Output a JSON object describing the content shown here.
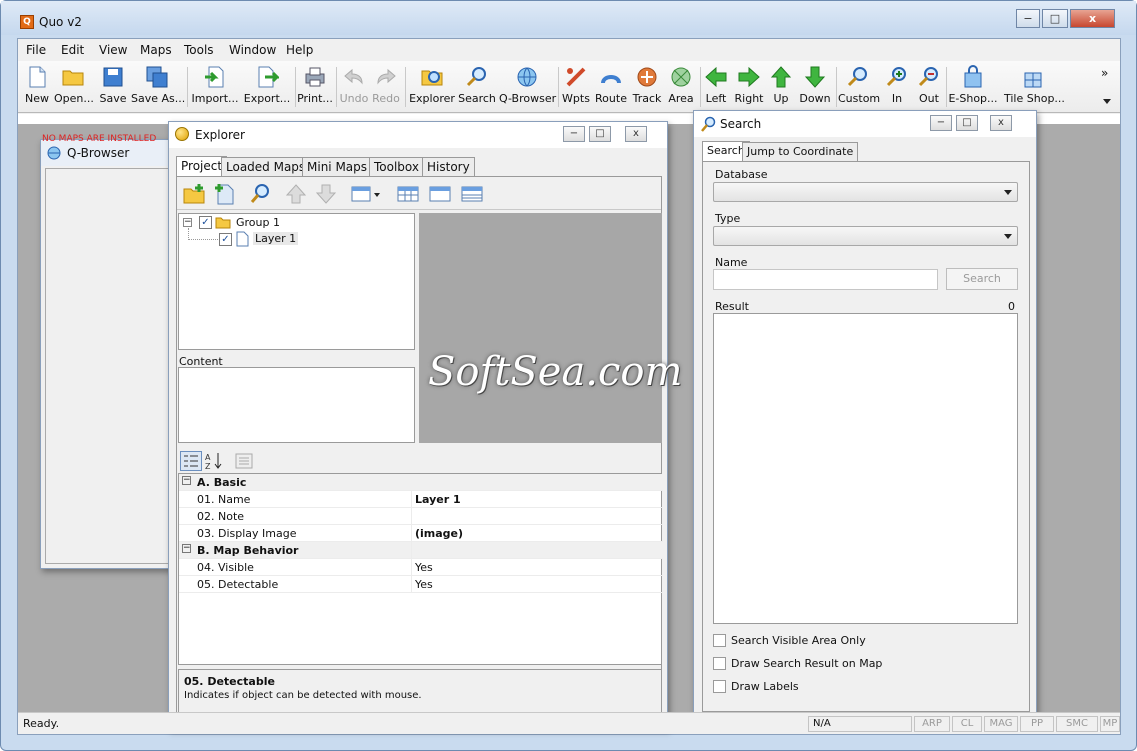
{
  "window": {
    "title": "Quo v2",
    "app_icon": "Q",
    "min": "−",
    "max": "□",
    "close": "x"
  },
  "menu": [
    "File",
    "Edit",
    "View",
    "Maps",
    "Tools",
    "Window",
    "Help"
  ],
  "toolbar": {
    "items": [
      "New",
      "Open...",
      "Save",
      "Save As...",
      "Import...",
      "Export...",
      "Print...",
      "Undo",
      "Redo",
      "Explorer",
      "Search",
      "Q-Browser",
      "Wpts",
      "Route",
      "Track",
      "Area",
      "Left",
      "Right",
      "Up",
      "Down",
      "Custom",
      "In",
      "Out",
      "E-Shop...",
      "Tile Shop..."
    ],
    "overflow": "»"
  },
  "status": {
    "ready": "Ready.",
    "coord": "N/A",
    "cells": [
      "ARP",
      "CL",
      "MAG",
      "PP",
      "SMC",
      "MP"
    ]
  },
  "qbrowser": {
    "title": "Q-Browser",
    "banner": "NO MAPS ARE INSTALLED"
  },
  "explorer": {
    "title": "Explorer",
    "tabs": [
      "Project",
      "Loaded Maps",
      "Mini Maps",
      "Toolbox",
      "History"
    ],
    "tree": {
      "group": "Group 1",
      "layer": "Layer 1",
      "expand": "−",
      "check": "✓"
    },
    "content_label": "Content",
    "props": [
      {
        "kind": "cat",
        "key": "A. Basic",
        "val": ""
      },
      {
        "kind": "row",
        "key": "01. Name",
        "val": "Layer 1"
      },
      {
        "kind": "row",
        "key": "02. Note",
        "val": ""
      },
      {
        "kind": "row",
        "key": "03. Display Image",
        "val": "(image)"
      },
      {
        "kind": "cat",
        "key": "B. Map Behavior",
        "val": ""
      },
      {
        "kind": "row",
        "key": "04. Visible",
        "val": "Yes"
      },
      {
        "kind": "row",
        "key": "05. Detectable",
        "val": "Yes"
      }
    ],
    "help_title": "05. Detectable",
    "help_text": "Indicates if object can be detected with mouse."
  },
  "search": {
    "title": "Search",
    "tabs": [
      "Search",
      "Jump to Coordinate"
    ],
    "database_label": "Database",
    "type_label": "Type",
    "name_label": "Name",
    "search_button": "Search",
    "result_label": "Result",
    "result_count": "0",
    "options": [
      "Search Visible Area Only",
      "Draw Search Result on Map",
      "Draw Labels"
    ]
  },
  "watermark": "SoftSea.com"
}
